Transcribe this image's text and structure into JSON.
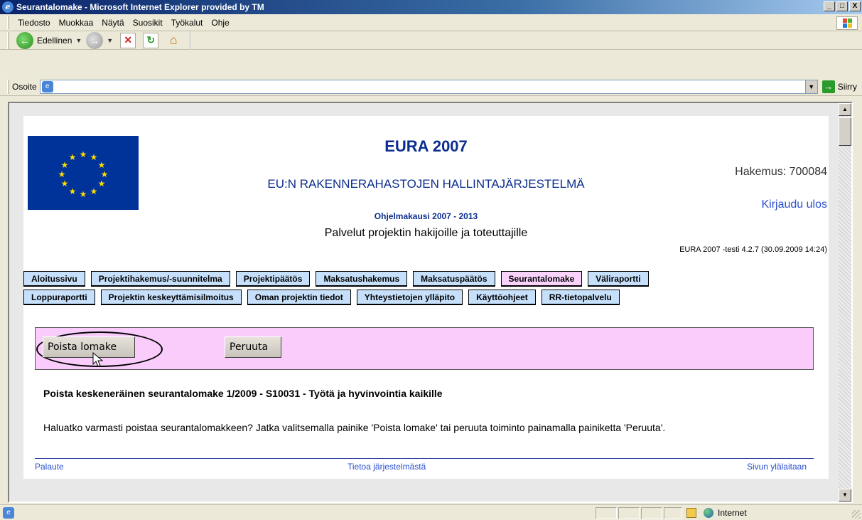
{
  "window": {
    "title": "Seurantalomake - Microsoft Internet Explorer provided by TM",
    "controls": [
      "_",
      "□",
      "X"
    ]
  },
  "menu": [
    "Tiedosto",
    "Muokkaa",
    "Näytä",
    "Suosikit",
    "Työkalut",
    "Ohje"
  ],
  "toolbar": {
    "back_label": "Edellinen"
  },
  "address": {
    "label": "Osoite",
    "value": "",
    "go_label": "Siirry"
  },
  "header": {
    "title": "EURA 2007",
    "subtitle": "EU:N RAKENNERAHASTOJEN HALLINTAJÄRJESTELMÄ",
    "program": "Ohjelmakausi 2007 - 2013",
    "services": "Palvelut projektin hakijoille ja toteuttajille",
    "application": "Hakemus: 700084",
    "logout": "Kirjaudu ulos",
    "version": "EURA 2007 -testi 4.2.7 (30.09.2009 14:24)"
  },
  "nav": {
    "row1": [
      "Aloitussivu",
      "Projektihakemus/-suunnitelma",
      "Projektipäätös",
      "Maksatushakemus",
      "Maksatuspäätös",
      "Seurantalomake",
      "Väliraportti"
    ],
    "row2": [
      "Loppuraportti",
      "Projektin keskeyttämisilmoitus",
      "Oman projektin tiedot",
      "Yhteystietojen ylläpito",
      "Käyttöohjeet",
      "RR-tietopalvelu"
    ],
    "active": "Seurantalomake"
  },
  "actions": {
    "delete_label": "Poista lomake",
    "cancel_label": "Peruuta"
  },
  "content": {
    "heading": "Poista keskeneräinen seurantalomake 1/2009 - S10031 - Työtä ja hyvinvointia kaikille",
    "text": "Haluatko varmasti poistaa seurantalomakkeen? Jatka valitsemalla painike 'Poista lomake' tai peruuta toiminto painamalla painiketta 'Peruuta'."
  },
  "footer": {
    "left": "Palaute",
    "center": "Tietoa järjestelmästä",
    "right": "Sivun ylälaitaan"
  },
  "status": {
    "zone": "Internet"
  },
  "colors": {
    "nav_button": "#c6e0fb",
    "nav_active": "#f9d3fb",
    "action_panel": "#f9ccfb",
    "title_blue": "#0b2d8e",
    "link_blue": "#2a4fd0",
    "eu_blue": "#003399",
    "eu_star": "#ffdd00"
  }
}
